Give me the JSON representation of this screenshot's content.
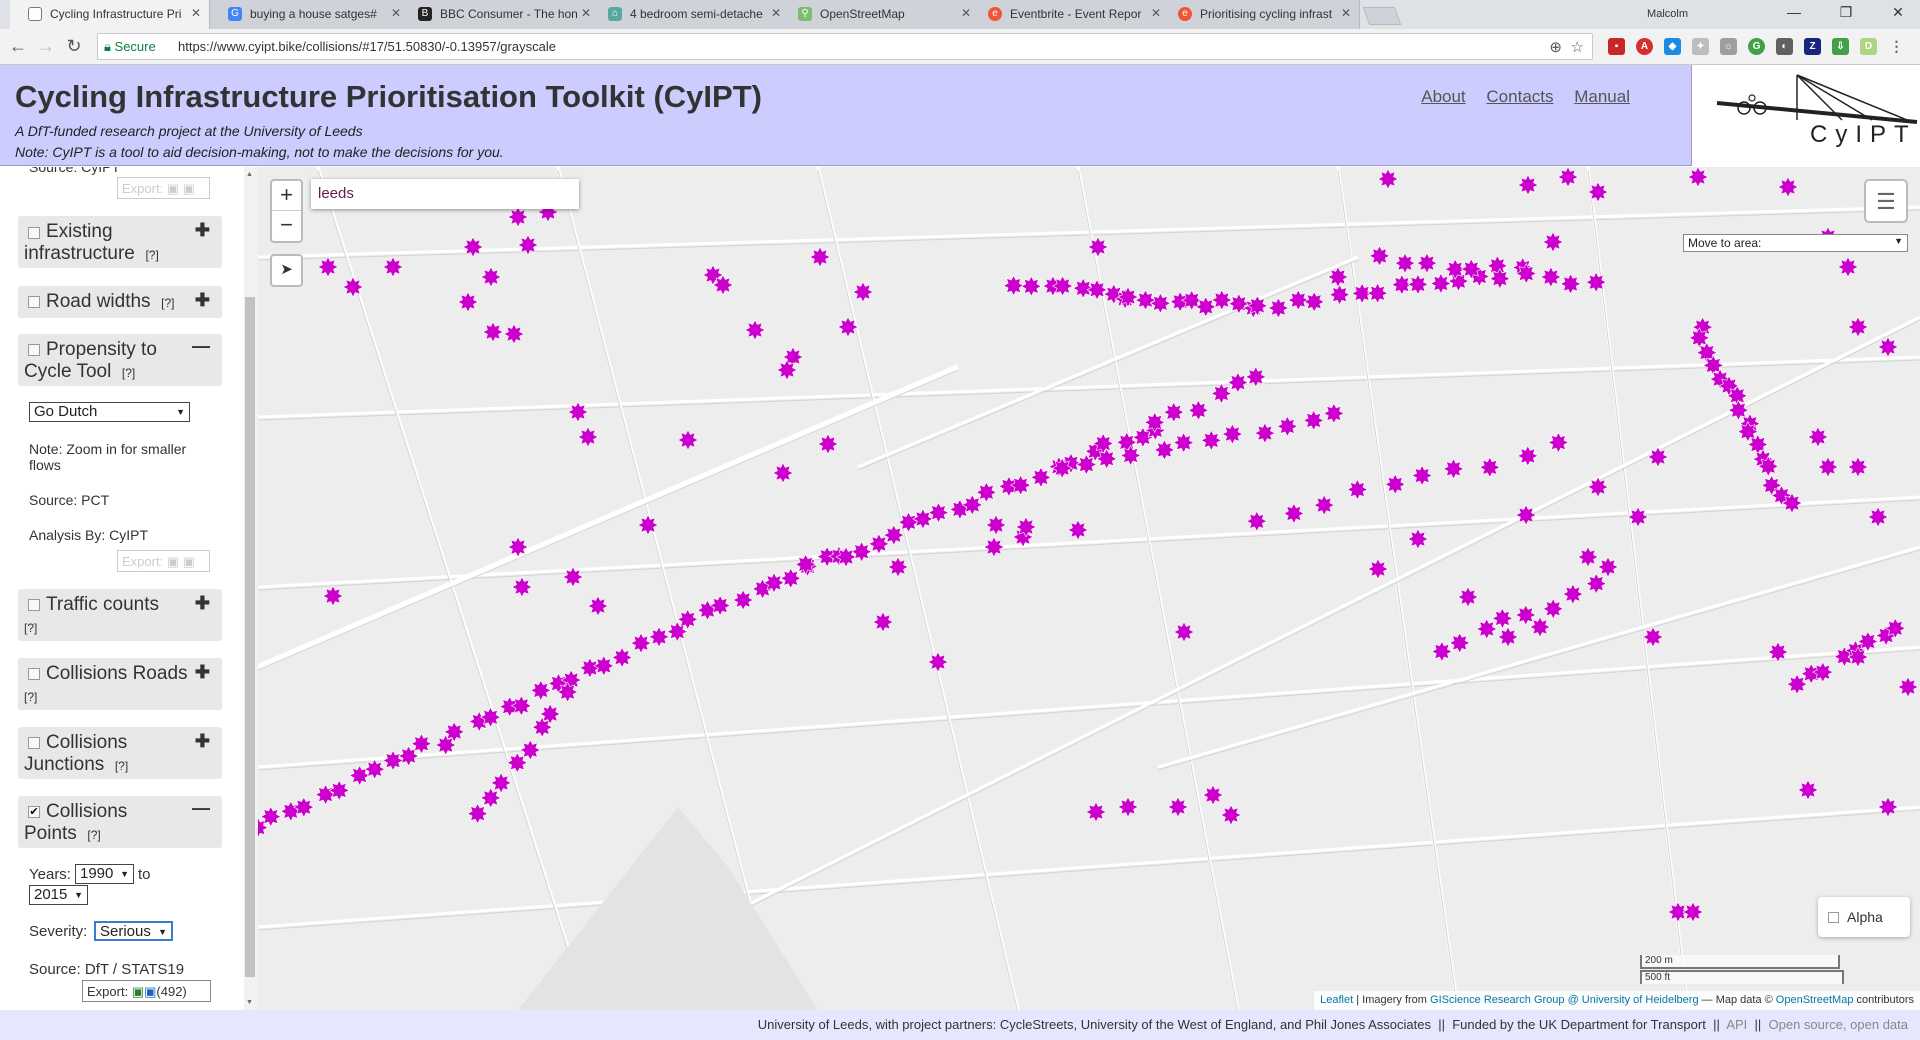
{
  "browser": {
    "tabs": [
      {
        "title": "Cycling Infrastructure Pri",
        "icon": "page-icon",
        "color": "#777777"
      },
      {
        "title": "buying a house satges#",
        "icon": "google-icon",
        "color": "#4285f4"
      },
      {
        "title": "BBC Consumer - The hon",
        "icon": "bbc-icon",
        "color": "#222222"
      },
      {
        "title": "4 bedroom semi-detache",
        "icon": "zoopla-icon",
        "color": "#5aa9a0"
      },
      {
        "title": "OpenStreetMap",
        "icon": "osm-icon",
        "color": "#7ebc6f"
      },
      {
        "title": "Eventbrite - Event Repor",
        "icon": "eventbrite-icon",
        "color": "#f05537"
      },
      {
        "title": "Prioritising cycling infrast",
        "icon": "eventbrite-icon",
        "color": "#f05537"
      }
    ],
    "user": "Malcolm",
    "secure_label": "Secure",
    "url": "https://www.cyipt.bike/collisions/#17/51.50830/-0.13957/grayscale"
  },
  "header": {
    "title": "Cycling Infrastructure Prioritisation Toolkit (CyIPT)",
    "subtitle": "A DfT-funded research project at the University of Leeds",
    "note": "Note: CyIPT is a tool to aid decision-making, not to make the decisions for you.",
    "links": {
      "about": "About",
      "contacts": "Contacts",
      "manual": "Manual"
    },
    "logo_text": "CyIPT"
  },
  "sidebar": {
    "top_source": "Source: CyIPT",
    "export_label": "Export:",
    "help": "[?]",
    "panels": {
      "existing": "Existing infrastructure",
      "road_widths": "Road widths",
      "pct": "Propensity to Cycle Tool",
      "traffic": "Traffic counts",
      "col_roads": "Collisions Roads",
      "col_junctions": "Collisions Junctions",
      "col_points": "Collisions Points"
    },
    "pct": {
      "scenario": "Go Dutch",
      "note": "Note: Zoom in for smaller flows",
      "source": "Source: PCT",
      "analysis": "Analysis By: CyIPT"
    },
    "collisions": {
      "years_label": "Years:",
      "from": "1990",
      "to_label": "to",
      "to": "2015",
      "severity_label": "Severity:",
      "severity": "Serious",
      "source": "Source: DfT / STATS19",
      "count": "(492)"
    }
  },
  "map": {
    "search_value": "leeds",
    "move_to": "Move to area:",
    "alpha_label": "Alpha",
    "scale_metric": "200 m",
    "scale_imperial": "500 ft",
    "attrib_leaflet": "Leaflet",
    "attrib_imagery": "| Imagery from",
    "attrib_giscience": "GIScience Research Group @ University of Heidelberg",
    "attrib_mapdata": "— Map data ©",
    "attrib_osm": "OpenStreetMap",
    "attrib_contrib": "contributors",
    "marker_color": "#cc00cc"
  },
  "footer": {
    "partners": "University of Leeds, with project partners: CycleStreets, University of the West of England, and Phil Jones Associates",
    "funded": "Funded by the UK Department for Transport",
    "api": "API",
    "open": "Open source, open data"
  }
}
